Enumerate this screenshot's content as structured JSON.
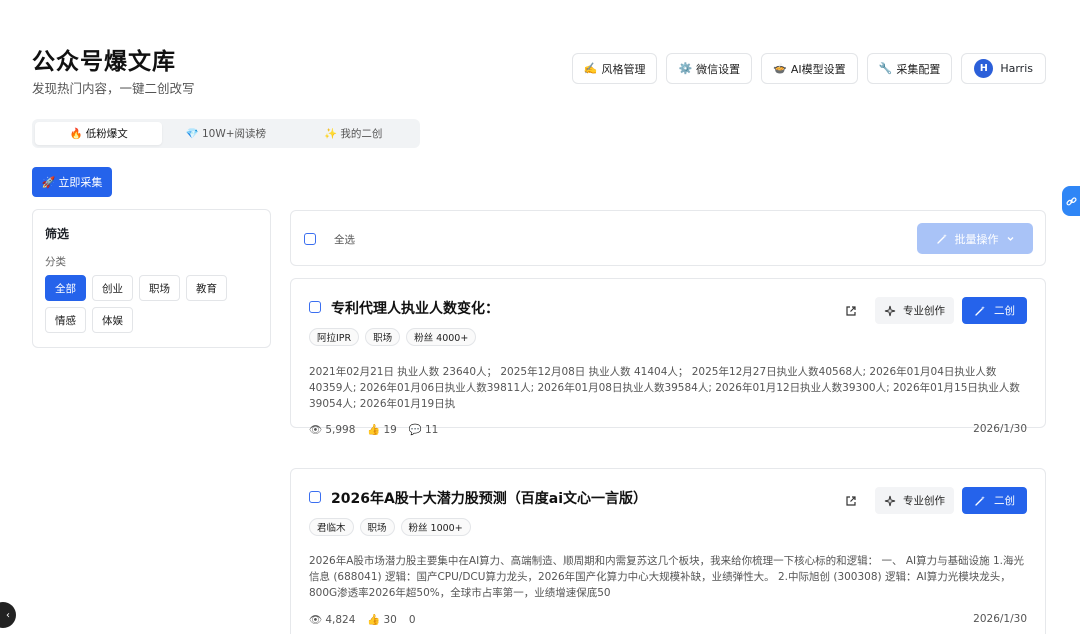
{
  "header": {
    "title": "公众号爆文库",
    "subtitle": "发现热门内容，一键二创改写"
  },
  "topbar": {
    "buttons": [
      {
        "icon": "✍️",
        "label": "风格管理",
        "name": "style-manage-button"
      },
      {
        "icon": "⚙️",
        "label": "微信设置",
        "name": "wechat-settings-button"
      },
      {
        "icon": "🍲",
        "label": "AI模型设置",
        "name": "ai-model-settings-button"
      },
      {
        "icon": "🔧",
        "label": "采集配置",
        "name": "collect-config-button"
      }
    ],
    "user": {
      "initial": "H",
      "name": "Harris"
    }
  },
  "tabs": [
    {
      "icon": "🔥",
      "label": "低粉爆文",
      "active": true
    },
    {
      "icon": "💎",
      "label": "10W+阅读榜",
      "active": false
    },
    {
      "icon": "✨",
      "label": "我的二创",
      "active": false
    }
  ],
  "collect_button": {
    "icon": "🚀",
    "label": "立即采集"
  },
  "filter": {
    "title": "筛选",
    "category_label": "分类",
    "chips": [
      {
        "label": "全部",
        "active": true
      },
      {
        "label": "创业",
        "active": false
      },
      {
        "label": "职场",
        "active": false
      },
      {
        "label": "教育",
        "active": false
      },
      {
        "label": "情感",
        "active": false
      },
      {
        "label": "体娱",
        "active": false
      }
    ]
  },
  "select_bar": {
    "select_all": "全选",
    "batch_label": "批量操作"
  },
  "article_actions": {
    "pro_label": "专业创作",
    "rewrite_label": "二创"
  },
  "articles": [
    {
      "title": "专利代理人执业人数变化：",
      "tags": [
        "阿拉IPR",
        "职场",
        "粉丝 4000+"
      ],
      "summary": "2021年02月21日 执业人数 23640人； 2025年12月08日 执业人数 41404人； 2025年12月27日执业人数40568人; 2026年01月04日执业人数40359人; 2026年01月06日执业人数39811人; 2026年01月08日执业人数39584人; 2026年01月12日执业人数39300人; 2026年01月15日执业人数39054人; 2026年01月19日执",
      "views": "5,998",
      "likes": "19",
      "comments": "11",
      "date": "2026/1/30"
    },
    {
      "title": "2026年A股十大潜力股预测（百度ai文心一言版）",
      "tags": [
        "君临木",
        "职场",
        "粉丝 1000+"
      ],
      "summary": "2026年A股市场潜力股主要集中在AI算力、高端制造、顺周期和内需复苏这几个板块，我来给你梳理一下核心标的和逻辑： 一、 AI算力与基础设施 1.海光信息 (688041) 逻辑：国产CPU/DCU算力龙头，2026年国产化算力中心大规模补缺，业绩弹性大。 2.中际旭创 (300308) 逻辑：AI算力光模块龙头，800G渗透率2026年超50%，全球市占率第一，业绩增速保底50",
      "views": "4,824",
      "likes": "30",
      "comments": "0",
      "date": "2026/1/30"
    }
  ],
  "icons": {
    "external_link": "external-link-icon",
    "views": "eye-icon",
    "likes": "thumbs-up-icon",
    "comments": "comment-icon"
  },
  "colors": {
    "primary": "#2563eb",
    "primary_disabled": "#a9c3f7",
    "border": "#e6e8eb"
  }
}
